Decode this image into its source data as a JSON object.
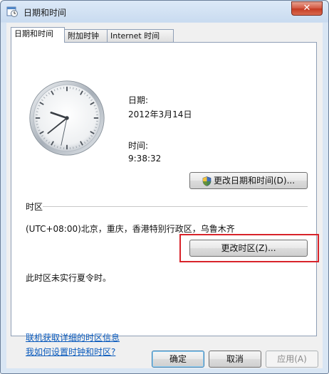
{
  "window": {
    "title": "日期和时间",
    "close_label": "✕"
  },
  "tabs": [
    {
      "label": "日期和时间"
    },
    {
      "label": "附加时钟"
    },
    {
      "label": "Internet 时间"
    }
  ],
  "date": {
    "label": "日期:",
    "value": "2012年3月14日"
  },
  "time": {
    "label": "时间:",
    "value": "9:38:32"
  },
  "change_datetime_button": {
    "label": "更改日期和时间(D)...",
    "icon": "uac-shield-icon"
  },
  "timezone": {
    "section_label": "时区",
    "value": "(UTC+08:00)北京，重庆，香港特别行政区，乌鲁木齐",
    "change_button": "更改时区(Z)...",
    "highlight_color": "#d8232a",
    "dst_note": "此时区未实行夏令时。"
  },
  "links": {
    "online_info": "联机获取详细的时区信息",
    "how_to": "我如何设置时钟和时区?"
  },
  "footer": {
    "ok": "确定",
    "cancel": "取消",
    "apply": "应用(A)"
  },
  "clock": {
    "hour": 9,
    "minute": 38,
    "second": 32
  }
}
